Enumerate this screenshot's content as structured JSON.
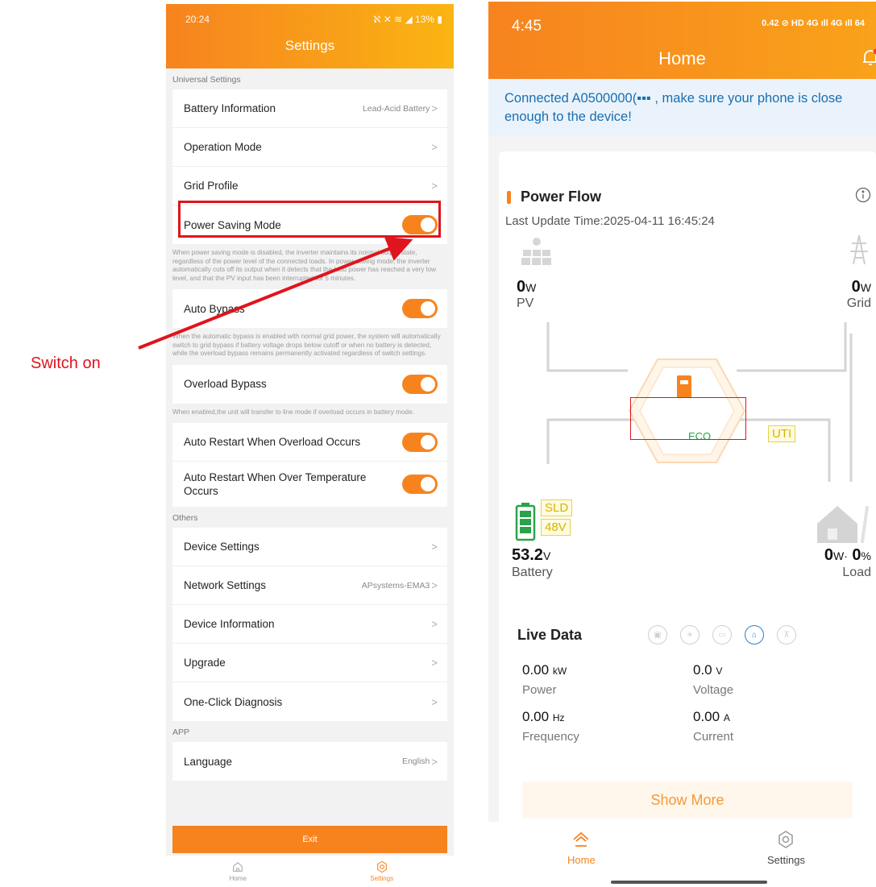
{
  "annotation": {
    "label": "Switch on",
    "color": "#e0141c"
  },
  "left_phone": {
    "status_time": "20:24",
    "status_right": "ℵ ✕ ≋ ◢ 13% ▮",
    "title": "Settings",
    "section_universal": "Universal Settings",
    "battery_info_label": "Battery Information",
    "battery_info_value": "Lead-Acid Battery",
    "operation_mode_label": "Operation Mode",
    "grid_profile_label": "Grid Profile",
    "power_saving_label": "Power Saving Mode",
    "power_saving_desc": "When power saving mode is disabled, the inverter maintains its normal output state, regardless of the power level of the connected loads. In power saving mode, the inverter automatically cuts off its output when it detects that the load power has reached a very low level, and that the PV input has been interrupted for 5 minutes.",
    "auto_bypass_label": "Auto Bypass",
    "auto_bypass_desc": "When the automatic bypass is enabled with normal grid power, the system will automatically switch to grid bypass if battery voltage drops below cutoff or when no battery is detected, while the overload bypass remains permanently activated regardless of switch settings.",
    "overload_bypass_label": "Overload Bypass",
    "overload_bypass_desc": "When enabled,the unit will transfer to line mode if overload occurs in battery mode.",
    "auto_restart_overload_label": "Auto Restart When Overload Occurs",
    "auto_restart_temp_label": "Auto Restart When Over Temperature Occurs",
    "section_others": "Others",
    "device_settings_label": "Device Settings",
    "network_settings_label": "Network Settings",
    "network_settings_value": "APsystems-EMA3",
    "device_info_label": "Device Information",
    "upgrade_label": "Upgrade",
    "diagnosis_label": "One-Click Diagnosis",
    "section_app": "APP",
    "language_label": "Language",
    "language_value": "English",
    "exit_label": "Exit",
    "tab_home": "Home",
    "tab_settings": "Settings",
    "chevron": ">"
  },
  "right_phone": {
    "status_time": "4:45",
    "status_right": "0.42 ⊘ HD 4G ıll 4G ıll 64",
    "title": "Home",
    "notice": "Connected A0500000(▪▪▪ , make sure your phone is close enough to the device!",
    "power_flow_title": "Power Flow",
    "last_update": "Last Update Time:2025-04-11 16:45:24",
    "pv_value": "0",
    "pv_unit": "W",
    "pv_label": "PV",
    "grid_value": "0",
    "grid_unit": "W",
    "grid_label": "Grid",
    "eco_label": "ECO",
    "uti_label": "UTI",
    "sld_label": "SLD",
    "v48_label": "48V",
    "battery_value": "53.2",
    "battery_unit": "V",
    "battery_label": "Battery",
    "load_value": "0",
    "load_unit": "W",
    "load_dot": "·",
    "load_pct": "0",
    "load_pct_unit": "%",
    "load_label": "Load",
    "live_title": "Live Data",
    "power_value": "0.00",
    "power_unit": "kW",
    "power_label": "Power",
    "voltage_value": "0.0",
    "voltage_unit": "V",
    "voltage_label": "Voltage",
    "freq_value": "0.00",
    "freq_unit": "Hz",
    "freq_label": "Frequency",
    "current_value": "0.00",
    "current_unit": "A",
    "current_label": "Current",
    "show_more": "Show More",
    "tab_home": "Home",
    "tab_settings": "Settings"
  },
  "colors": {
    "accent": "#f7831f",
    "highlight": "#e0141c",
    "eco": "#2aa24a",
    "link": "#1a6fb0"
  }
}
